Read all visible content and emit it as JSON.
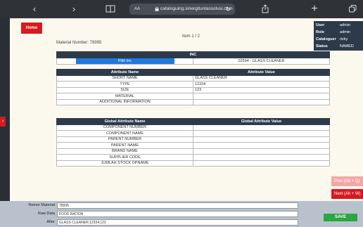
{
  "browser": {
    "url": "cataloguing.sinergituntassolusi.com",
    "aa_label": "AA"
  },
  "page": {
    "home_label": "Home",
    "item_label": "Item 1 / 2",
    "material_number_label": "Material Number: 78995"
  },
  "user_info": [
    {
      "key": "User",
      "value": "admin"
    },
    {
      "key": "Role",
      "value": "admin"
    },
    {
      "key": "Cataloguer",
      "value": "rizky"
    },
    {
      "key": "Status",
      "value": "NAMED"
    }
  ],
  "inc": {
    "header": "INC",
    "select_value": "Pilih Inc",
    "value": "02594 - GLASS CLEANER"
  },
  "attributes": {
    "headers": [
      "Attribute Name",
      "Attribute Value"
    ],
    "rows": [
      {
        "name": "SHORT NAME",
        "value": "GLASS CLEANER"
      },
      {
        "name": "TYPE",
        "value": "12334"
      },
      {
        "name": "SIZE",
        "value": "123"
      },
      {
        "name": "MATERIAL",
        "value": ""
      },
      {
        "name": "ADDITIONAL INFORMATION",
        "value": ""
      }
    ]
  },
  "global_attributes": {
    "headers": [
      "Global Attribute Name",
      "Global Attribute Value"
    ],
    "rows": [
      {
        "name": "COMPONENT NUMBER",
        "value": ""
      },
      {
        "name": "COMPONENT NAME",
        "value": ""
      },
      {
        "name": "PARENT NUMBER",
        "value": ""
      },
      {
        "name": "PARENT NAME",
        "value": ""
      },
      {
        "name": "BRAND NAME",
        "value": ""
      },
      {
        "name": "SUPPLIER CODE",
        "value": ""
      },
      {
        "name": "JUMLAH STOCK OPNAME",
        "value": ""
      }
    ]
  },
  "nav": {
    "prev_label": "Prev (Alt + Q)",
    "next_label": "Next (Alt + W)"
  },
  "bottom": {
    "rows": [
      {
        "label": "Nomor Material",
        "value": "78995"
      },
      {
        "label": "Raw Data",
        "value": "FOOD RATION"
      },
      {
        "label": "After",
        "value": "GLASS CLEANER;12334;123"
      }
    ],
    "save_label": "SAVE"
  },
  "colors": {
    "primary_red": "#d71920",
    "header_navy": "#2d3a4a",
    "select_blue": "#1f7ae0",
    "save_green": "#28a745"
  }
}
